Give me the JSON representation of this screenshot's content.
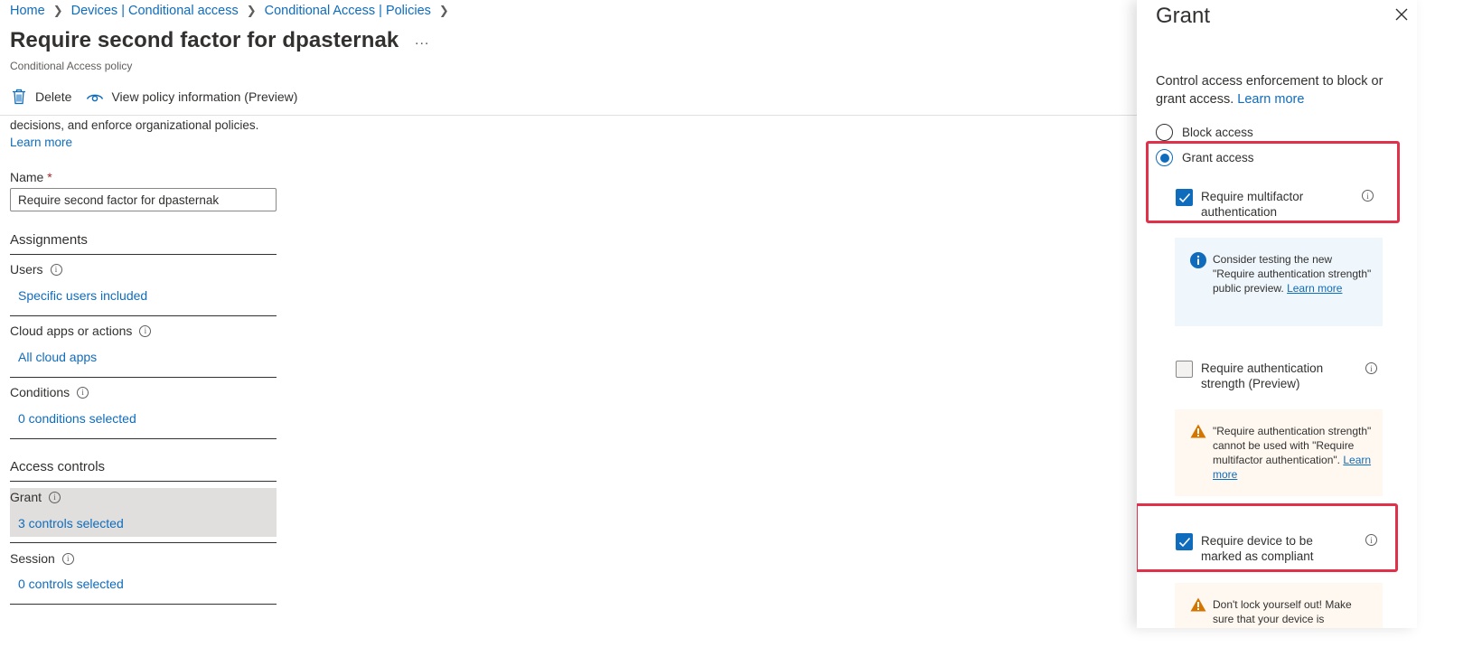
{
  "breadcrumb": [
    "Home",
    "Devices | Conditional access",
    "Conditional Access | Policies"
  ],
  "page": {
    "title": "Require second factor for dpasternak",
    "more": "...",
    "subtitle": "Conditional Access policy"
  },
  "toolbar": {
    "delete_label": "Delete",
    "view_info_label": "View policy information (Preview)"
  },
  "intro": {
    "text": "decisions, and enforce organizational policies.",
    "learn_more": "Learn more"
  },
  "name_field": {
    "label": "Name",
    "required_mark": "*",
    "value": "Require second factor for dpasternak"
  },
  "assignments": {
    "heading": "Assignments",
    "users_label": "Users",
    "users_value": "Specific users included",
    "cloud_label": "Cloud apps or actions",
    "cloud_value": "All cloud apps",
    "conditions_label": "Conditions",
    "conditions_value": "0 conditions selected"
  },
  "access_controls": {
    "heading": "Access controls",
    "grant_label": "Grant",
    "grant_value": "3 controls selected",
    "session_label": "Session",
    "session_value": "0 controls selected"
  },
  "grant_panel": {
    "title": "Grant",
    "description": "Control access enforcement to block or grant access.",
    "learn_more": "Learn more",
    "block_label": "Block access",
    "grant_label": "Grant access",
    "selected_option": "Grant access",
    "mfa_label": "Require multifactor authentication",
    "mfa_checked": true,
    "info_message": "Consider testing the new \"Require authentication strength\" public preview.",
    "info_learn_more": "Learn more",
    "auth_strength_label": "Require authentication strength (Preview)",
    "auth_strength_checked": false,
    "warn_message": "\"Require authentication strength\" cannot be used with \"Require multifactor authentication\".",
    "warn_learn_more": "Learn more",
    "compliant_label": "Require device to be marked as compliant",
    "compliant_checked": true,
    "lockout_message": "Don't lock yourself out! Make sure that your device is"
  },
  "colors": {
    "accent": "#0f6cbd",
    "highlight": "#e0304a",
    "warning": "#d47500",
    "info_bg": "#eff6fc",
    "warn_bg": "#fff8f0"
  }
}
